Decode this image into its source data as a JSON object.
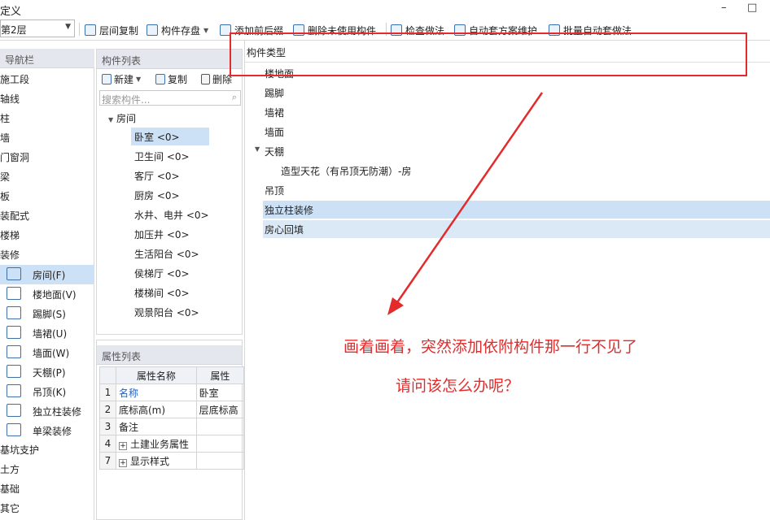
{
  "window": {
    "title": "定义",
    "minimize": "–",
    "maximize": "□"
  },
  "toolbar": {
    "floor": "第2层",
    "copy_floor": "层间复制",
    "save_component": "构件存盘",
    "add_prefix_suffix": "添加前后缀",
    "delete_unused": "删除未使用构件",
    "check_method": "检查做法",
    "auto_scheme": "自动套方案维护",
    "batch_auto": "批量自动套做法"
  },
  "nav": {
    "header": "导航栏",
    "items": [
      "施工段",
      "轴线",
      "柱",
      "墙",
      "门窗洞",
      "梁",
      "板",
      "装配式",
      "楼梯",
      "装修"
    ],
    "sub_items": [
      {
        "label": "房间(F)",
        "icon": "house-icon",
        "active": true
      },
      {
        "label": "楼地面(V)",
        "icon": "floor-icon",
        "active": false
      },
      {
        "label": "踢脚(S)",
        "icon": "skirting-icon",
        "active": false
      },
      {
        "label": "墙裙(U)",
        "icon": "dado-icon",
        "active": false
      },
      {
        "label": "墙面(W)",
        "icon": "wall-face-icon",
        "active": false
      },
      {
        "label": "天棚(P)",
        "icon": "ceiling-icon",
        "active": false
      },
      {
        "label": "吊顶(K)",
        "icon": "suspended-ceiling-icon",
        "active": false
      },
      {
        "label": "独立柱装修",
        "icon": "column-finish-icon",
        "active": false
      },
      {
        "label": "单梁装修",
        "icon": "beam-finish-icon",
        "active": false
      }
    ],
    "bottom_items": [
      "基坑支护",
      "土方",
      "基础",
      "其它"
    ]
  },
  "component_list": {
    "header": "构件列表",
    "new_label": "新建",
    "copy_label": "复制",
    "delete_label": "删除",
    "search_placeholder": "搜索构件...",
    "tree_root": "房间",
    "items": [
      "卧室 <0>",
      "卫生间 <0>",
      "客厅 <0>",
      "厨房 <0>",
      "水井、电井 <0>",
      "加压井 <0>",
      "生活阳台 <0>",
      "侯梯厅 <0>",
      "楼梯间 <0>",
      "观景阳台 <0>"
    ],
    "selected_index": 0
  },
  "properties": {
    "header": "属性列表",
    "col_name": "属性名称",
    "col_value": "属性",
    "rows": [
      {
        "num": "1",
        "name": "名称",
        "value": "卧室",
        "blue": true,
        "expand": false
      },
      {
        "num": "2",
        "name": "底标高(m)",
        "value": "层底标高",
        "blue": false,
        "expand": false
      },
      {
        "num": "3",
        "name": "备注",
        "value": "",
        "blue": false,
        "expand": false
      },
      {
        "num": "4",
        "name": "土建业务属性",
        "value": "",
        "blue": false,
        "expand": true
      },
      {
        "num": "7",
        "name": "显示样式",
        "value": "",
        "blue": false,
        "expand": true
      }
    ]
  },
  "component_types": {
    "header": "构件类型",
    "items": [
      "楼地面",
      "踢脚",
      "墙裙",
      "墙面",
      "天棚",
      "造型天花（有吊顶无防潮）-房",
      "吊顶",
      "独立柱装修",
      "房心回填"
    ]
  },
  "annotation": {
    "line1": "画着画着，突然添加依附构件那一行不见了",
    "line2": "请问该怎么办呢？",
    "color": "#e32b2b"
  }
}
